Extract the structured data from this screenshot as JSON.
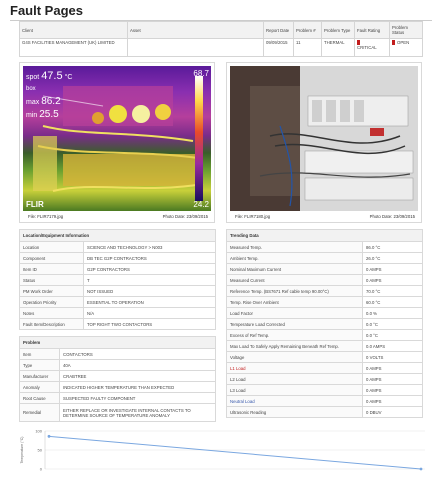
{
  "page": {
    "title": "Fault Pages"
  },
  "header": {
    "columns": [
      "Client",
      "Asset",
      "Report Date",
      "Problem #",
      "Problem Type",
      "Fault Rating",
      "Problem Status"
    ],
    "row": {
      "client": "G4S FACILITIES MANAGEMENT (UK) LIMITED",
      "asset": "",
      "report_date": "09/09/2015",
      "problem_no": "11",
      "problem_type": "THERMAL",
      "fault_rating": "CRITICAL",
      "problem_status": "OPEN"
    },
    "colors": {
      "critical": "#c21d1d",
      "open": "#c21d1d"
    }
  },
  "images": {
    "thermal": {
      "spot_label": "spot",
      "spot_value": "47.5",
      "unit": "°C",
      "box_label": "box",
      "max_label": "max",
      "max_value": "86.2",
      "min_label": "min",
      "min_value": "25.5",
      "scale_top": "68.7",
      "scale_bottom": "24.2",
      "brand": "FLIR",
      "file": "File: FLIR7179.jpg",
      "photo_date": "Photo Date: 23/09/2015"
    },
    "visual": {
      "file": "File: FLIR7180.jpg",
      "photo_date": "Photo Date: 23/09/2015"
    }
  },
  "location": {
    "heading": "Location/Equipment Information",
    "rows": [
      {
        "label": "Location",
        "value": "SCIENCE AND TECHNOLOGY > N003"
      },
      {
        "label": "Component",
        "value": "DB TEC G2P CONTRACTORS"
      },
      {
        "label": "Item ID",
        "value": "G2P CONTRACTORS"
      },
      {
        "label": "Status",
        "value": "T"
      },
      {
        "label": "PM Work Order",
        "value": "NOT ISSUED"
      },
      {
        "label": "Operation Priority",
        "value": "ESSENTIAL TO OPERATION"
      },
      {
        "label": "Notes",
        "value": "N/A"
      },
      {
        "label": "Fault Item/Description",
        "value": "TOP RIGHT TWO CONTACTORS"
      }
    ]
  },
  "problem": {
    "heading": "Problem",
    "rows": [
      {
        "label": "Item",
        "value": "CONTACTORS"
      },
      {
        "label": "Type",
        "value": "40A"
      },
      {
        "label": "Manufacturer",
        "value": "CRABTREE"
      },
      {
        "label": "Anomaly",
        "value": "INDICATED HIGHER TEMPERATURE THAN EXPECTED"
      },
      {
        "label": "Root Cause",
        "value": "SUSPECTED FAULTY COMPONENT"
      },
      {
        "label": "Remedial",
        "value": "EITHER REPLACE OR INVESTIGATE INTERNAL CONTACTS TO DETERMINE SOURCE OF TEMPERATURE ANOMALY"
      }
    ]
  },
  "trending": {
    "heading": "Trending Data",
    "rows": [
      {
        "label": "Measured Temp.",
        "value": "86.0 °C"
      },
      {
        "label": "Ambient Temp.",
        "value": "26.0 °C"
      },
      {
        "label": "Nominal Maximum Current",
        "value": "0 AMPS"
      },
      {
        "label": "Measured Current",
        "value": "0 AMPS"
      },
      {
        "label": "Reference Temp. (BS7671 Ref cable temp 90.00°C)",
        "value": "70.0 °C"
      },
      {
        "label": "Temp. Rise Over Ambient",
        "value": "60.0 °C"
      },
      {
        "label": "Load Factor",
        "value": "0.0 %"
      },
      {
        "label": "Temperature Load Corrected",
        "value": "0.0 °C"
      },
      {
        "label": "Excess of Ref Temp.",
        "value": "0.0 °C"
      },
      {
        "label": "Max Load To Safely Apply Remaining Beneath Ref Temp.",
        "value": "0.0 AMPS"
      },
      {
        "label": "Voltage",
        "value": "0 VOLTS"
      },
      {
        "label": "L1 Load",
        "value": "0 AMPS"
      },
      {
        "label": "L2 Load",
        "value": "0 AMPS"
      },
      {
        "label": "L3 Load",
        "value": "0 AMPS"
      },
      {
        "label": "Neutral Load",
        "value": "0 AMPS"
      },
      {
        "label": "Ultrasonic Reading",
        "value": "0 DBUV"
      }
    ]
  },
  "chart_data": {
    "type": "line",
    "title": "",
    "xlabel": "",
    "ylabel": "Temperature (°C)",
    "ylim": [
      0,
      100
    ],
    "yticks": [
      "100",
      "50",
      "0"
    ],
    "series": [
      {
        "values": [
          86,
          0
        ]
      }
    ],
    "grid": true,
    "color": "#7aa7e0"
  }
}
